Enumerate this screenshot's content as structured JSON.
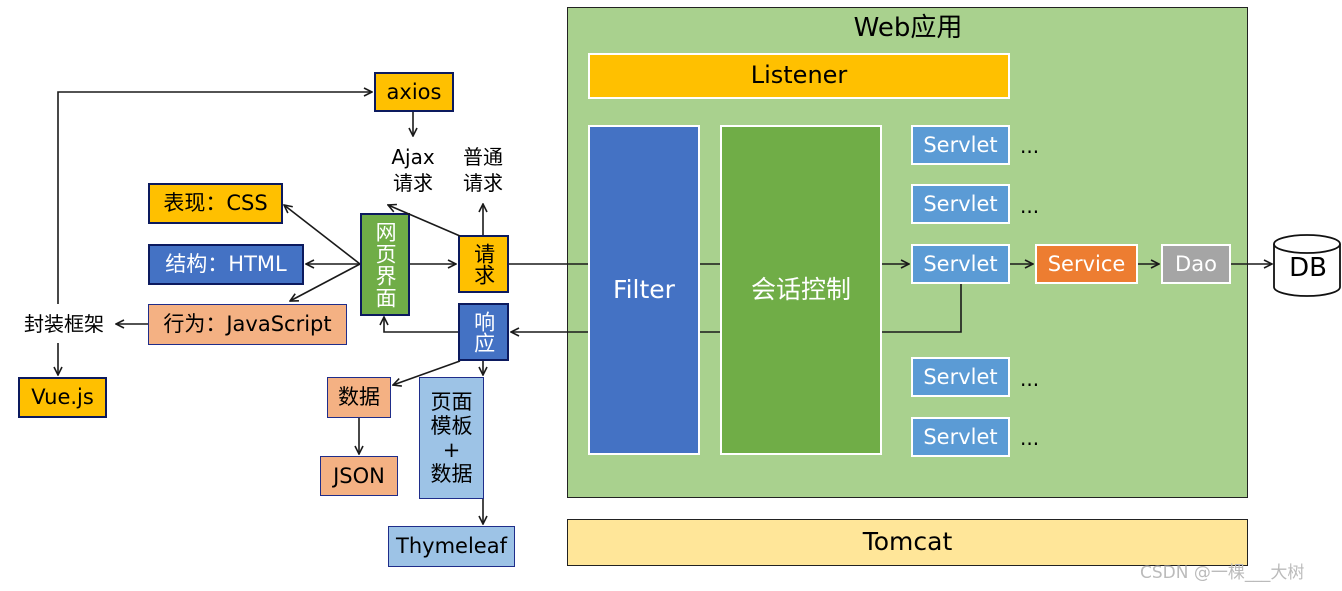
{
  "web_app": {
    "title": "Web应用",
    "listener": "Listener",
    "filter": "Filter",
    "session": "会话控制",
    "servlets": [
      "Servlet",
      "Servlet",
      "Servlet",
      "Servlet",
      "Servlet"
    ],
    "ellipsis": "...",
    "service": "Service",
    "dao": "Dao"
  },
  "db": "DB",
  "tomcat": "Tomcat",
  "client": {
    "axios": "axios",
    "ajax_request": [
      "Ajax",
      "请求"
    ],
    "normal_request": [
      "普通",
      "请求"
    ],
    "css": "表现：CSS",
    "html": "结构：HTML",
    "js": "行为：JavaScript",
    "framework": "封装框架",
    "vue": "Vue.js",
    "webpage": "网页界面",
    "request": "请求",
    "response": "响应",
    "data": "数据",
    "json": "JSON",
    "template": [
      "页面",
      "模板",
      "+",
      "数据"
    ],
    "thymeleaf": "Thymeleaf"
  },
  "watermark": "CSDN @一棵___大树",
  "colors": {
    "web_app_bg": "#a9d18e",
    "listener": "#ffc000",
    "filter": "#4472c4",
    "session": "#70ad47",
    "servlet": "#5b9bd5",
    "service": "#ed7d31",
    "dao": "#a5a5a5",
    "tomcat": "#ffe699",
    "yellow": "#ffc000",
    "blue": "#4472c4",
    "salmon": "#f4b183",
    "light_blue": "#9dc3e6"
  }
}
